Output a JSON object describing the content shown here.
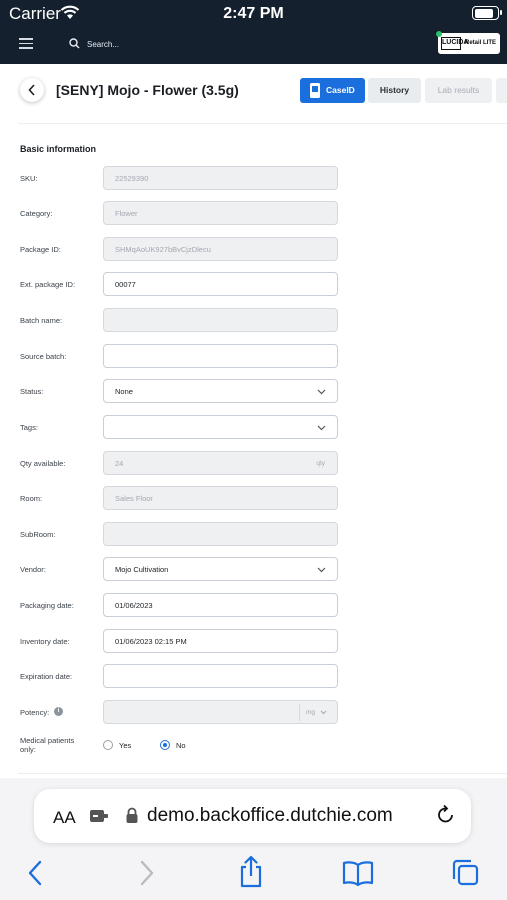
{
  "status_bar": {
    "carrier": "Carrier",
    "time": "2:47 PM",
    "battery_level": 0.9
  },
  "app_header": {
    "search_placeholder": "Search...",
    "brand_logo": "LUCIDA",
    "brand_text": "Retail LITE"
  },
  "page": {
    "title": "[SENY] Mojo - Flower (3.5g)",
    "tabs": [
      {
        "label": "CaseID",
        "active": true
      },
      {
        "label": "History",
        "active": false
      },
      {
        "label": "Lab results",
        "active": false
      }
    ]
  },
  "form": {
    "section_title": "Basic information",
    "fields": [
      {
        "label": "SKU:",
        "value": "22529390",
        "disabled": true
      },
      {
        "label": "Category:",
        "value": "Flower",
        "disabled": true
      },
      {
        "label": "Package ID:",
        "value": "SHMqAoUK927bBvCjzDlecu",
        "disabled": true
      },
      {
        "label": "Ext. package ID:",
        "value": "00077",
        "disabled": false
      },
      {
        "label": "Batch name:",
        "value": "",
        "disabled": true
      },
      {
        "label": "Source batch:",
        "value": "",
        "disabled": false
      },
      {
        "label": "Status:",
        "value": "None",
        "disabled": false,
        "dropdown": true
      },
      {
        "label": "Tags:",
        "value": "",
        "disabled": false,
        "dropdown": true
      },
      {
        "label": "Qty available:",
        "value": "24",
        "suffix": "qty",
        "disabled": true
      },
      {
        "label": "Room:",
        "value": "Sales Floor",
        "disabled": true
      },
      {
        "label": "SubRoom:",
        "value": "",
        "disabled": true
      },
      {
        "label": "Vendor:",
        "value": "Mojo Cultivation",
        "disabled": false,
        "dropdown": true
      },
      {
        "label": "Packaging date:",
        "value": "01/06/2023",
        "disabled": false
      },
      {
        "label": "Inventory date:",
        "value": "01/06/2023 02:15 PM",
        "disabled": false
      },
      {
        "label": "Expiration date:",
        "value": "",
        "disabled": false
      },
      {
        "label": "Potency:",
        "value": "",
        "unit": "mg",
        "disabled": true,
        "info": true
      }
    ],
    "medical": {
      "label": "Medical patients only:",
      "options": [
        {
          "label": "Yes",
          "checked": false
        },
        {
          "label": "No",
          "checked": true
        }
      ]
    }
  },
  "browser": {
    "text_size_label": "AA",
    "url": "demo.backoffice.dutchie.com",
    "toolbar_icons": [
      "back-icon",
      "forward-icon",
      "share-icon",
      "bookmarks-icon",
      "tabs-icon"
    ]
  },
  "colors": {
    "header_bg": "#14202e",
    "accent": "#1a6fdc"
  }
}
